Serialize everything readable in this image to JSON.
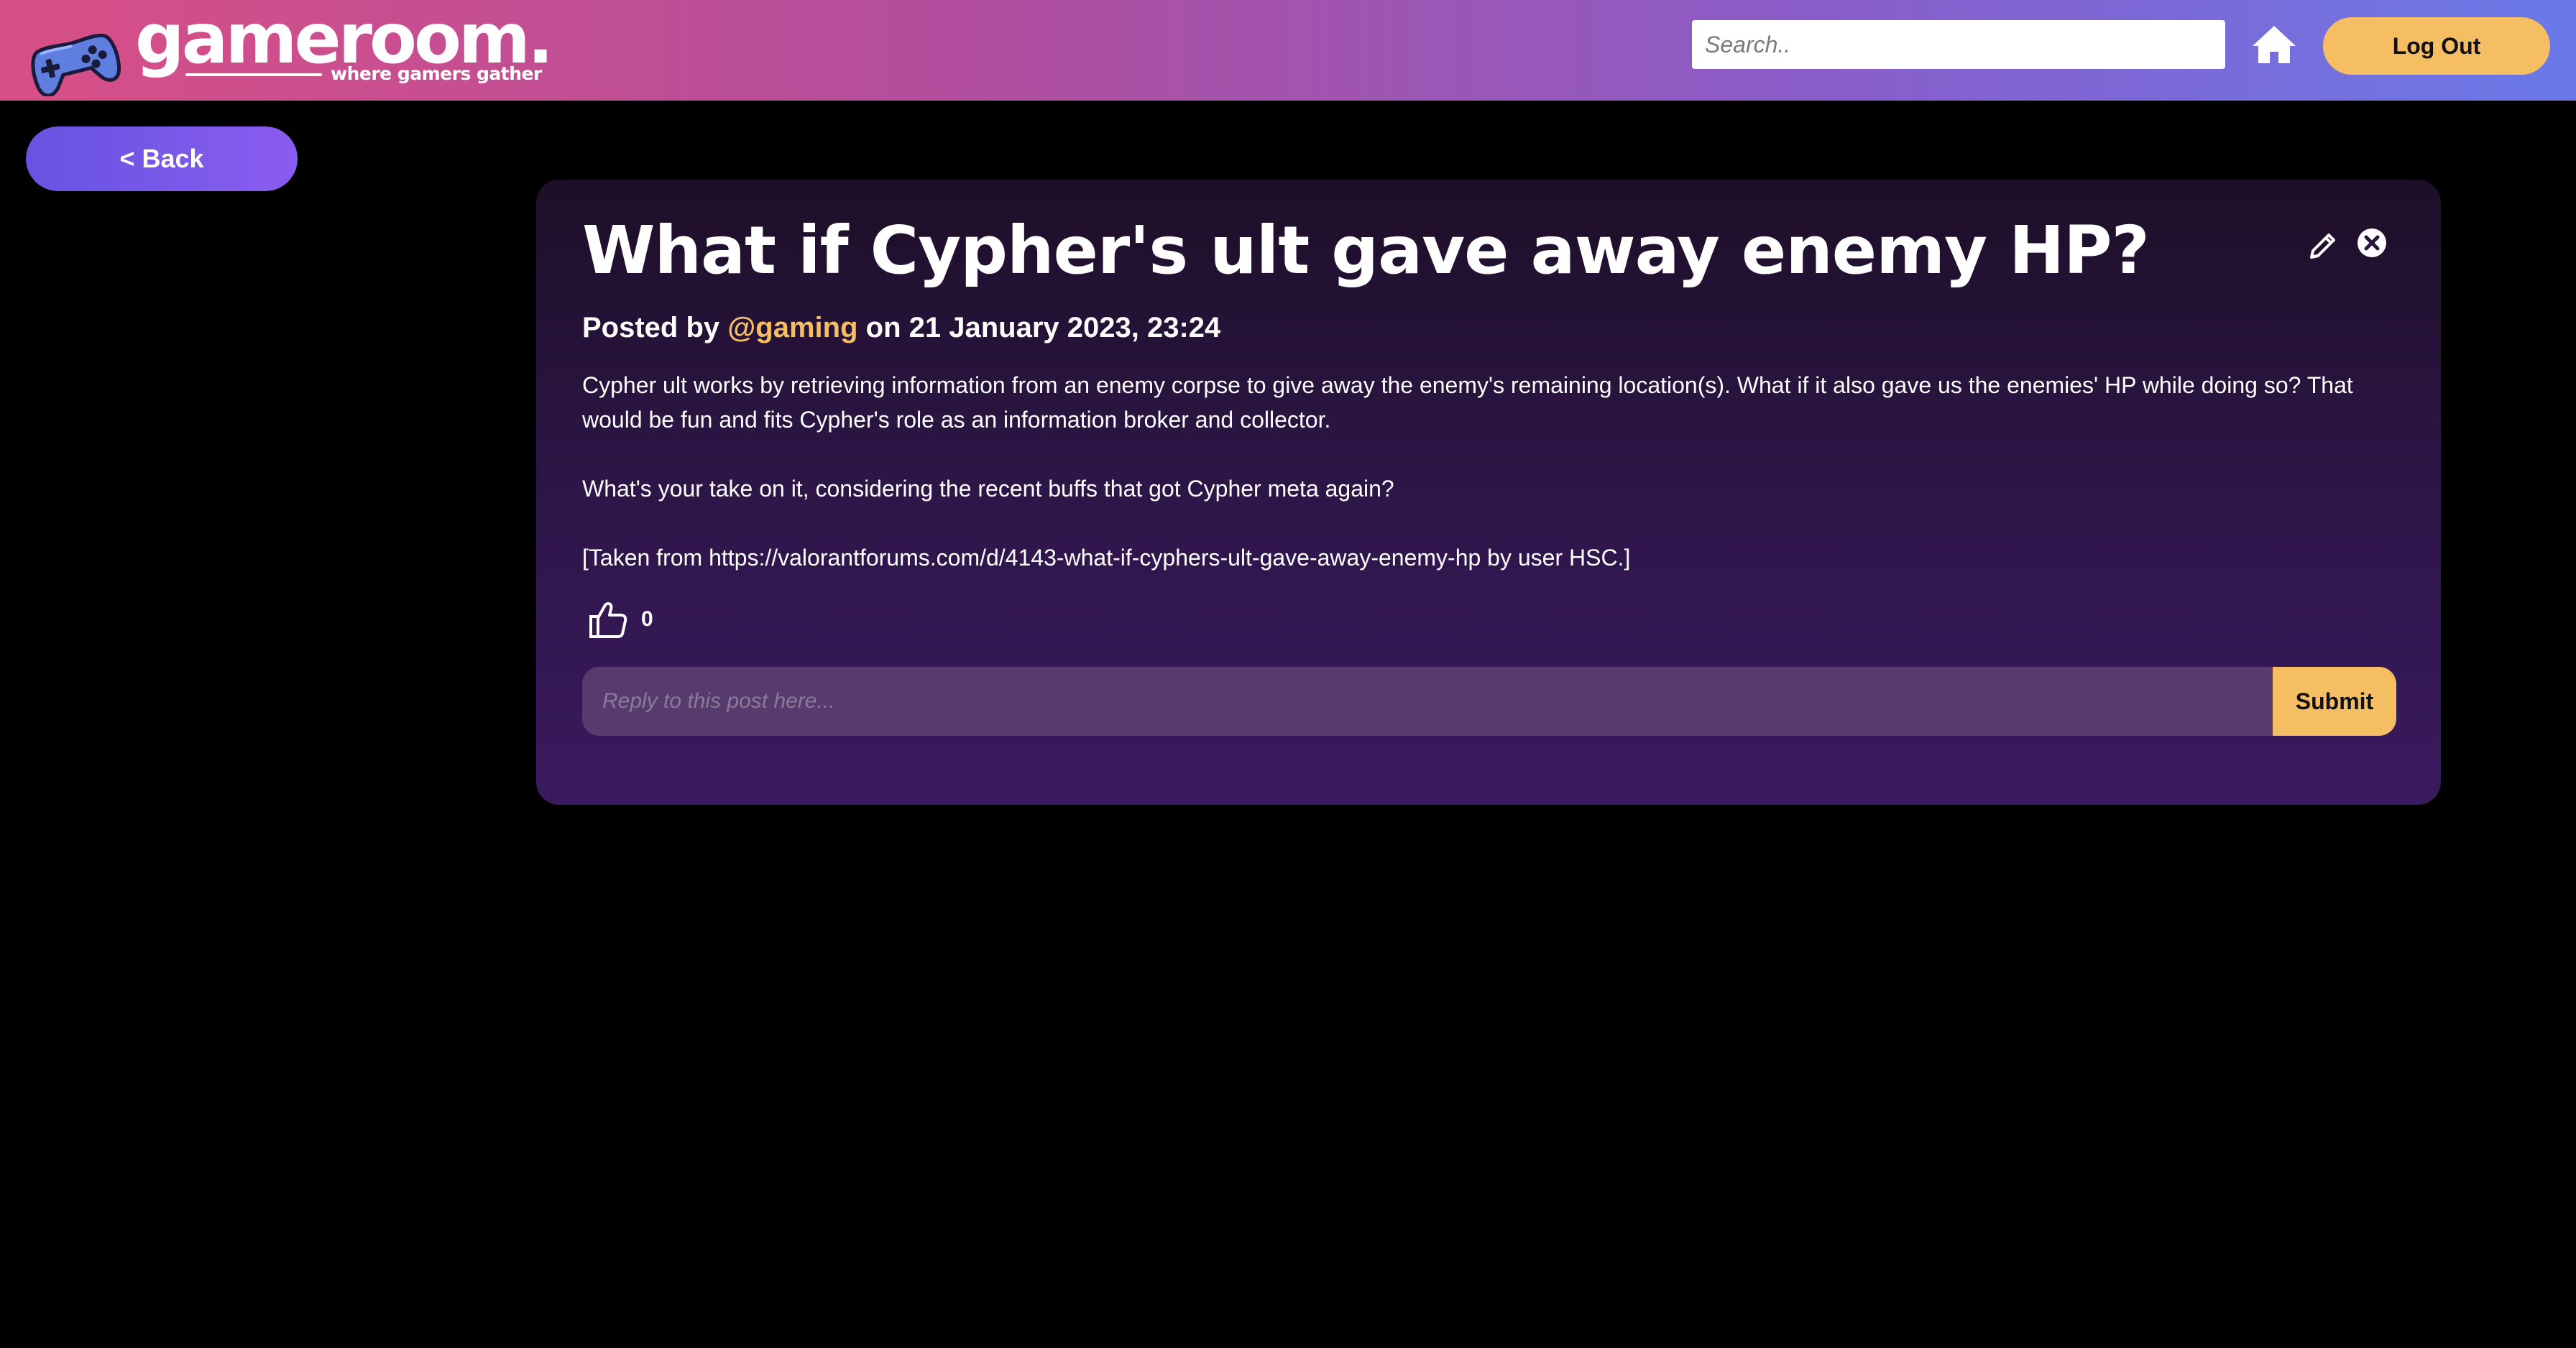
{
  "header": {
    "logo_text": "gameroom.",
    "tagline": "where gamers gather",
    "search_placeholder": "Search..",
    "logout_label": "Log Out",
    "gradient": [
      "#d84f86",
      "#6a79e8"
    ]
  },
  "nav": {
    "back_label": "< Back"
  },
  "post": {
    "title": "What if Cypher's ult gave away enemy HP?",
    "posted_by_prefix": "Posted by",
    "author": "@gaming",
    "date_prefix": "on",
    "date": "21 January 2023, 23:24",
    "body": [
      "Cypher ult works by retrieving information from an enemy corpse to give away the enemy's remaining location(s). What if it also gave us the enemies' HP while doing so? That would be fun and fits Cypher's role as an information broker and collector.",
      "What's your take on it, considering the recent buffs that got Cypher meta again?",
      "[Taken from https://valorantforums.com/d/4143-what-if-cyphers-ult-gave-away-enemy-hp by user HSC.]"
    ],
    "likes": "0"
  },
  "reply": {
    "placeholder": "Reply to this post here...",
    "submit_label": "Submit"
  },
  "colors": {
    "accent": "#f5be62",
    "background": "#000000",
    "card_bottom": "#3a1a60"
  },
  "icons": [
    "gamepad-logo-icon",
    "home-icon",
    "edit-icon",
    "delete-icon",
    "thumbs-up-icon"
  ]
}
